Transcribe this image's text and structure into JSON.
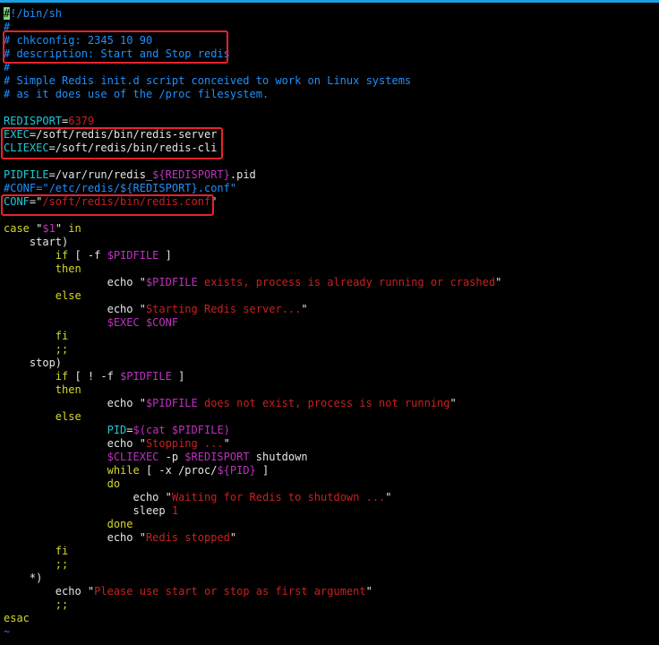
{
  "colors": {
    "background": "#000000",
    "default": "#e6e6e6",
    "comment": "#1e90ff",
    "variable": "#1fc8d8",
    "string": "#cc1f1f",
    "keyword": "#d7d72a",
    "expansion": "#c030c0",
    "cursor": "#7fd67f",
    "tilde": "#4466ff",
    "highlight_box": "#e8232b",
    "top_border": "#1aa0e0"
  },
  "lines": [
    [
      {
        "t": "#",
        "c": "cursor"
      },
      {
        "t": "!/bin/sh",
        "c": "comment"
      }
    ],
    [
      {
        "t": "#",
        "c": "comment"
      }
    ],
    [
      {
        "t": "# chkconfig: 2345 10 90",
        "c": "comment"
      }
    ],
    [
      {
        "t": "# description: Start and Stop redis",
        "c": "comment"
      }
    ],
    [
      {
        "t": "#",
        "c": "comment"
      }
    ],
    [
      {
        "t": "# Simple Redis init.d script conceived to work on Linux systems",
        "c": "comment"
      }
    ],
    [
      {
        "t": "# as it does use of the /proc filesystem.",
        "c": "comment"
      }
    ],
    [],
    [
      {
        "t": "REDISPORT",
        "c": "variable"
      },
      {
        "t": "=",
        "c": "default"
      },
      {
        "t": "6379",
        "c": "string"
      }
    ],
    [
      {
        "t": "EXEC",
        "c": "variable"
      },
      {
        "t": "=/soft/redis/bin/redis-server",
        "c": "default"
      }
    ],
    [
      {
        "t": "CLIEXEC",
        "c": "variable"
      },
      {
        "t": "=/soft/redis/bin/redis-cli",
        "c": "default"
      }
    ],
    [],
    [
      {
        "t": "PIDFILE",
        "c": "variable"
      },
      {
        "t": "=/var/run/redis_",
        "c": "default"
      },
      {
        "t": "${REDISPORT}",
        "c": "expansion"
      },
      {
        "t": ".pid",
        "c": "default"
      }
    ],
    [
      {
        "t": "#CONF=\"/etc/redis/${REDISPORT}.conf\"",
        "c": "comment"
      }
    ],
    [
      {
        "t": "CONF",
        "c": "variable"
      },
      {
        "t": "=\"",
        "c": "default"
      },
      {
        "t": "/soft/redis/bin/redis.conf",
        "c": "string"
      },
      {
        "t": "\"",
        "c": "default"
      }
    ],
    [],
    [
      {
        "t": "case ",
        "c": "keyword"
      },
      {
        "t": "\"",
        "c": "default"
      },
      {
        "t": "$1",
        "c": "expansion"
      },
      {
        "t": "\" ",
        "c": "default"
      },
      {
        "t": "in",
        "c": "keyword"
      }
    ],
    [
      {
        "t": "    start)",
        "c": "default"
      }
    ],
    [
      {
        "t": "        if ",
        "c": "keyword"
      },
      {
        "t": "[ -f ",
        "c": "default"
      },
      {
        "t": "$PIDFILE",
        "c": "expansion"
      },
      {
        "t": " ]",
        "c": "default"
      }
    ],
    [
      {
        "t": "        then",
        "c": "keyword"
      }
    ],
    [
      {
        "t": "                echo ",
        "c": "default"
      },
      {
        "t": "\"",
        "c": "default"
      },
      {
        "t": "$PIDFILE",
        "c": "expansion"
      },
      {
        "t": " exists, process is already running or crashed",
        "c": "string"
      },
      {
        "t": "\"",
        "c": "default"
      }
    ],
    [
      {
        "t": "        else",
        "c": "keyword"
      }
    ],
    [
      {
        "t": "                echo ",
        "c": "default"
      },
      {
        "t": "\"",
        "c": "default"
      },
      {
        "t": "Starting Redis server...",
        "c": "string"
      },
      {
        "t": "\"",
        "c": "default"
      }
    ],
    [
      {
        "t": "                ",
        "c": "default"
      },
      {
        "t": "$EXEC",
        "c": "expansion"
      },
      {
        "t": " ",
        "c": "default"
      },
      {
        "t": "$CONF",
        "c": "expansion"
      }
    ],
    [
      {
        "t": "        fi",
        "c": "keyword"
      }
    ],
    [
      {
        "t": "        ;;",
        "c": "keyword"
      }
    ],
    [
      {
        "t": "    stop)",
        "c": "default"
      }
    ],
    [
      {
        "t": "        if ",
        "c": "keyword"
      },
      {
        "t": "[ ! -f ",
        "c": "default"
      },
      {
        "t": "$PIDFILE",
        "c": "expansion"
      },
      {
        "t": " ]",
        "c": "default"
      }
    ],
    [
      {
        "t": "        then",
        "c": "keyword"
      }
    ],
    [
      {
        "t": "                echo ",
        "c": "default"
      },
      {
        "t": "\"",
        "c": "default"
      },
      {
        "t": "$PIDFILE",
        "c": "expansion"
      },
      {
        "t": " does not exist, process is not running",
        "c": "string"
      },
      {
        "t": "\"",
        "c": "default"
      }
    ],
    [
      {
        "t": "        else",
        "c": "keyword"
      }
    ],
    [
      {
        "t": "                PID",
        "c": "variable"
      },
      {
        "t": "=",
        "c": "default"
      },
      {
        "t": "$(cat ",
        "c": "expansion"
      },
      {
        "t": "$PIDFILE",
        "c": "expansion"
      },
      {
        "t": ")",
        "c": "expansion"
      }
    ],
    [
      {
        "t": "                echo ",
        "c": "default"
      },
      {
        "t": "\"",
        "c": "default"
      },
      {
        "t": "Stopping ...",
        "c": "string"
      },
      {
        "t": "\"",
        "c": "default"
      }
    ],
    [
      {
        "t": "                ",
        "c": "default"
      },
      {
        "t": "$CLIEXEC",
        "c": "expansion"
      },
      {
        "t": " -p ",
        "c": "default"
      },
      {
        "t": "$REDISPORT",
        "c": "expansion"
      },
      {
        "t": " shutdown",
        "c": "default"
      }
    ],
    [
      {
        "t": "                while ",
        "c": "keyword"
      },
      {
        "t": "[ -x /proc/",
        "c": "default"
      },
      {
        "t": "${PID}",
        "c": "expansion"
      },
      {
        "t": " ]",
        "c": "default"
      }
    ],
    [
      {
        "t": "                do",
        "c": "keyword"
      }
    ],
    [
      {
        "t": "                    echo ",
        "c": "default"
      },
      {
        "t": "\"",
        "c": "default"
      },
      {
        "t": "Waiting for Redis to shutdown ...",
        "c": "string"
      },
      {
        "t": "\"",
        "c": "default"
      }
    ],
    [
      {
        "t": "                    sleep ",
        "c": "default"
      },
      {
        "t": "1",
        "c": "string"
      }
    ],
    [
      {
        "t": "                done",
        "c": "keyword"
      }
    ],
    [
      {
        "t": "                echo ",
        "c": "default"
      },
      {
        "t": "\"",
        "c": "default"
      },
      {
        "t": "Redis stopped",
        "c": "string"
      },
      {
        "t": "\"",
        "c": "default"
      }
    ],
    [
      {
        "t": "        fi",
        "c": "keyword"
      }
    ],
    [
      {
        "t": "        ;;",
        "c": "keyword"
      }
    ],
    [
      {
        "t": "    *)",
        "c": "default"
      }
    ],
    [
      {
        "t": "        echo ",
        "c": "default"
      },
      {
        "t": "\"",
        "c": "default"
      },
      {
        "t": "Please use start or stop as first argument",
        "c": "string"
      },
      {
        "t": "\"",
        "c": "default"
      }
    ],
    [
      {
        "t": "        ;;",
        "c": "keyword"
      }
    ],
    [
      {
        "t": "esac",
        "c": "keyword"
      }
    ],
    [
      {
        "t": "~",
        "c": "tilde"
      }
    ]
  ]
}
